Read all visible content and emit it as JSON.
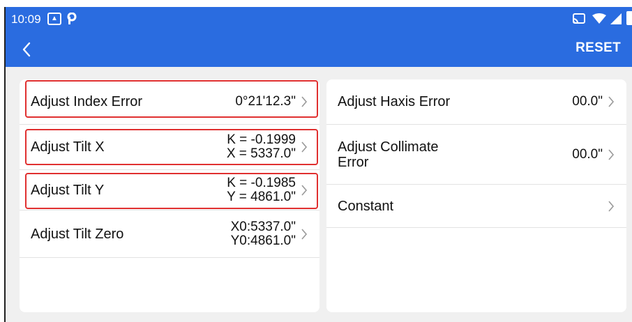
{
  "status_bar": {
    "time": "10:09",
    "icons": [
      "gallery-icon",
      "p-app-icon",
      "cast-icon",
      "wifi-icon",
      "signal-icon",
      "battery-icon"
    ]
  },
  "toolbar": {
    "back_icon": "chevron-left-icon",
    "reset_label": "RESET"
  },
  "left_list": [
    {
      "label": "Adjust Index Error",
      "value_lines": [
        "0°21'12.3\""
      ],
      "highlighted": true
    },
    {
      "label": "Adjust Tilt X",
      "value_lines": [
        "K = -0.1999",
        "X = 5337.0\""
      ],
      "highlighted": true
    },
    {
      "label": "Adjust Tilt Y",
      "value_lines": [
        "K = -0.1985",
        "Y = 4861.0\""
      ],
      "highlighted": true
    },
    {
      "label": "Adjust Tilt Zero",
      "value_lines": [
        "X0:5337.0\"",
        "Y0:4861.0\""
      ],
      "highlighted": false
    }
  ],
  "right_list": [
    {
      "label": "Adjust Haxis Error",
      "value_lines": [
        "00.0\""
      ]
    },
    {
      "label": "Adjust Collimate\nError",
      "value_lines": [
        "00.0\""
      ]
    },
    {
      "label": "Constant",
      "value_lines": []
    }
  ],
  "colors": {
    "app_bar": "#2a6ce0",
    "highlight": "#e03030",
    "background": "#f0f0f0"
  }
}
